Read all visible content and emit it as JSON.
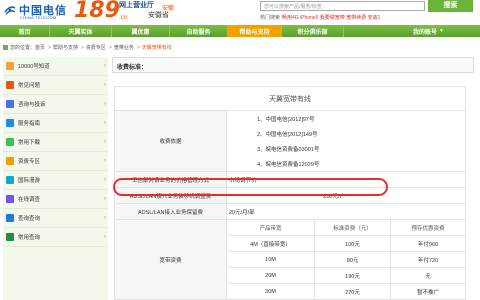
{
  "header": {
    "logo_cn": "中国电信",
    "logo_en": "CHINA TELECOM",
    "logo_num": "189",
    "logo_suffix": ".cn",
    "slogan": "网上营业厅",
    "province_arrow": "安徽",
    "province": "安徽省",
    "search_placeholder": "您可以搜索产品/服务/标签",
    "search_button": "搜索",
    "hot_label": "热门搜索：",
    "hot_links": "畅用4G    iPhone5    我要做宽带    宽带续费    安装1"
  },
  "nav": {
    "home": "首页",
    "tianyi": "天翼实体",
    "hui": "翼优惠",
    "self": "自助服务",
    "support": "帮助与支持",
    "points": "积分俱乐部",
    "account": "我的账号"
  },
  "breadcrumb": [
    "您的位置：首页",
    "帮助与支持",
    "资费专区",
    "宽带业务",
    "天翼宽带有线"
  ],
  "sidebar": {
    "items": [
      {
        "label": "10000号知道"
      },
      {
        "label": "常见问题"
      },
      {
        "label": "咨询与投诉"
      },
      {
        "label": "服务指南"
      },
      {
        "label": "常用下载"
      },
      {
        "label": "资费专区"
      },
      {
        "label": "国际漫游"
      },
      {
        "label": "在线调查"
      },
      {
        "label": "查询查询"
      },
      {
        "label": "常用查询"
      }
    ]
  },
  "page": {
    "head_title": "收费标准：",
    "table_title": "天翼宽带有线",
    "basis_label": "收费依据",
    "basis_items": [
      "1、中国电信[2012]97号",
      "2、中国电信[2012]149号",
      "3、皖电信资费备03001号",
      "4、皖电信资费备12029号"
    ],
    "mgmt_label": "工信部对该业务的价格管理方式",
    "mgmt_value": "市场调节价",
    "install_label": "ADSL/LAN接入业务装移机调整费",
    "install_value": "200元/户",
    "keep_label": "ADSL/LAN接入业务保留费",
    "keep_value": "20元/月/部",
    "fee_label": "宽带资费",
    "headers": [
      "产品带宽",
      "标准资费（元）",
      "预存优惠资费"
    ],
    "rows": [
      [
        "4M（直接带宽）",
        "100元",
        "年付960"
      ],
      [
        "10M",
        "80元",
        "年付720"
      ],
      [
        "20M",
        "190元",
        "无"
      ],
      [
        "30M",
        "270元",
        "暂不推广"
      ]
    ]
  }
}
